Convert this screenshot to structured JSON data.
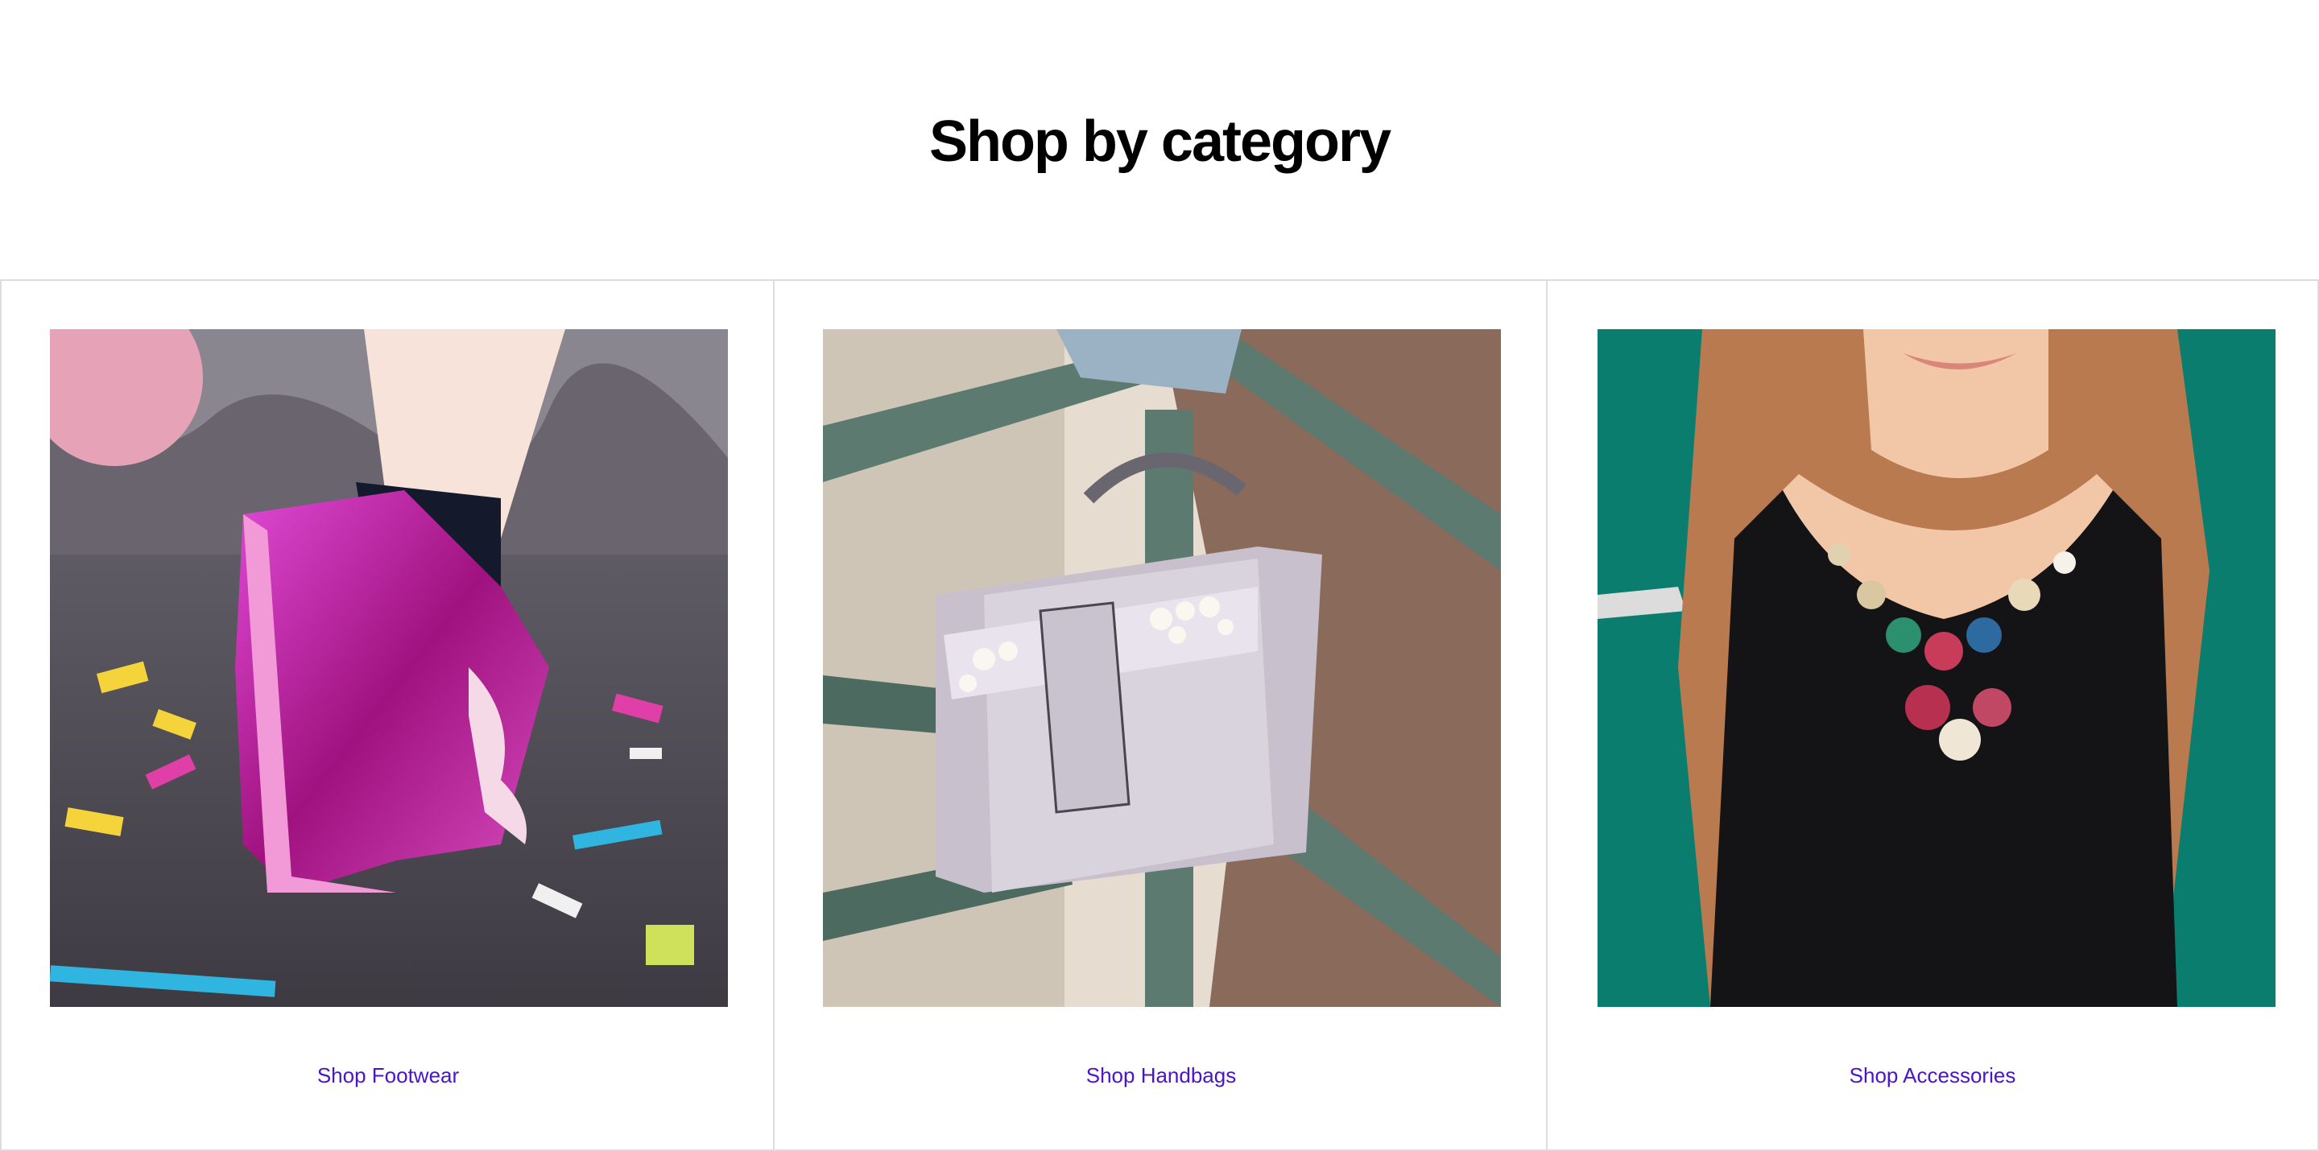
{
  "section": {
    "title": "Shop by category"
  },
  "categories": [
    {
      "link_label": "Shop Footwear",
      "image_icon": "metallic-pink-sneaker-photo"
    },
    {
      "link_label": "Shop Handbags",
      "image_icon": "pearl-handbag-photo"
    },
    {
      "link_label": "Shop Accessories",
      "image_icon": "statement-necklace-photo"
    }
  ],
  "colors": {
    "link": "#4a14c8",
    "heading": "#000000",
    "border": "#dddddd"
  }
}
